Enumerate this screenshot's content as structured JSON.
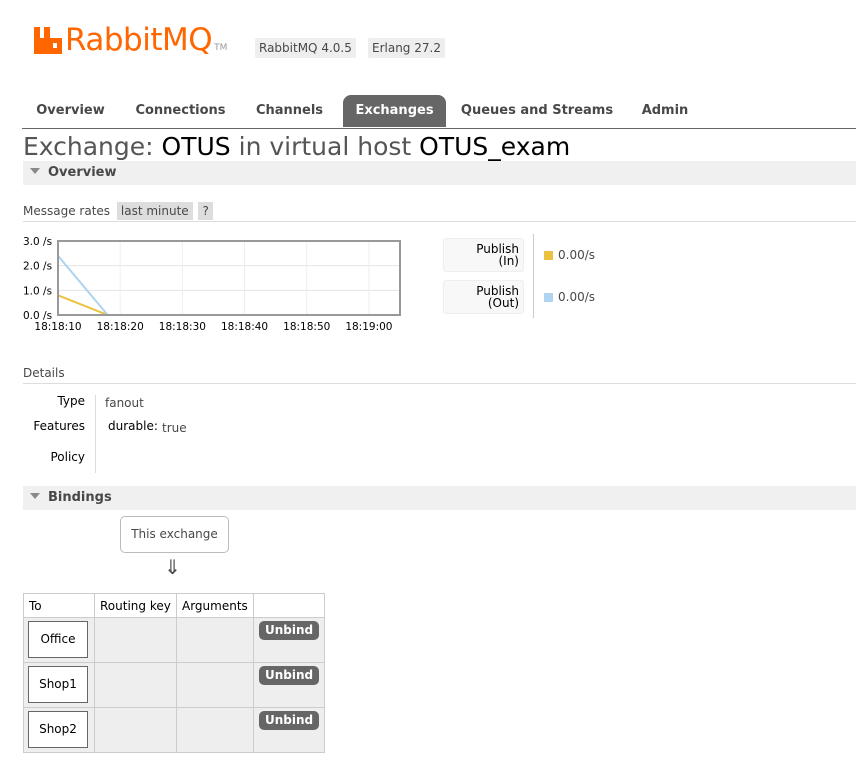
{
  "header": {
    "logo_text": "RabbitMQ",
    "logo_tm": "TM",
    "version": "RabbitMQ 4.0.5",
    "erlang": "Erlang 27.2"
  },
  "nav": {
    "tabs": [
      {
        "label": "Overview",
        "active": false
      },
      {
        "label": "Connections",
        "active": false
      },
      {
        "label": "Channels",
        "active": false
      },
      {
        "label": "Exchanges",
        "active": true
      },
      {
        "label": "Queues and Streams",
        "active": false
      },
      {
        "label": "Admin",
        "active": false
      }
    ]
  },
  "page": {
    "title_prefix": "Exchange:",
    "exchange_name": "OTUS",
    "title_middle": "in virtual host",
    "vhost": "OTUS_exam"
  },
  "overview": {
    "section_label": "Overview",
    "rates_label": "Message rates",
    "rates_range": "last minute",
    "help": "?",
    "legend": [
      {
        "line1": "Publish",
        "line2": "(In)",
        "value": "0.00/s",
        "color": "#ebc23f"
      },
      {
        "line1": "Publish",
        "line2": "(Out)",
        "value": "0.00/s",
        "color": "#aed4f0"
      }
    ]
  },
  "chart_data": {
    "type": "line",
    "y_tick_labels": [
      "3.0 /s",
      "2.0 /s",
      "1.0 /s",
      "0.0 /s"
    ],
    "x_tick_labels": [
      "18:18:10",
      "18:18:20",
      "18:18:30",
      "18:18:40",
      "18:18:50",
      "18:19:00"
    ],
    "ylim": [
      0,
      3
    ],
    "xlim": [
      "18:18:10",
      "18:19:05"
    ],
    "grid": true,
    "series": [
      {
        "name": "Publish (In)",
        "color": "#ebc23f",
        "x": [
          "18:18:10",
          "18:18:18",
          "18:19:05"
        ],
        "values": [
          0.8,
          0.0,
          0.0
        ]
      },
      {
        "name": "Publish (Out)",
        "color": "#aed4f0",
        "x": [
          "18:18:10",
          "18:18:18",
          "18:19:05"
        ],
        "values": [
          2.4,
          0.0,
          0.0
        ]
      }
    ]
  },
  "details": {
    "heading": "Details",
    "type_label": "Type",
    "type_value": "fanout",
    "features_label": "Features",
    "durable_key": "durable:",
    "durable_value": "true",
    "policy_label": "Policy"
  },
  "bindings": {
    "section_label": "Bindings",
    "this_exchange": "This exchange",
    "arrow": "⇓",
    "columns": [
      "To",
      "Routing key",
      "Arguments",
      ""
    ],
    "rows": [
      {
        "to": "Office",
        "routing_key": "",
        "arguments": "",
        "action": "Unbind"
      },
      {
        "to": "Shop1",
        "routing_key": "",
        "arguments": "",
        "action": "Unbind"
      },
      {
        "to": "Shop2",
        "routing_key": "",
        "arguments": "",
        "action": "Unbind"
      }
    ]
  }
}
